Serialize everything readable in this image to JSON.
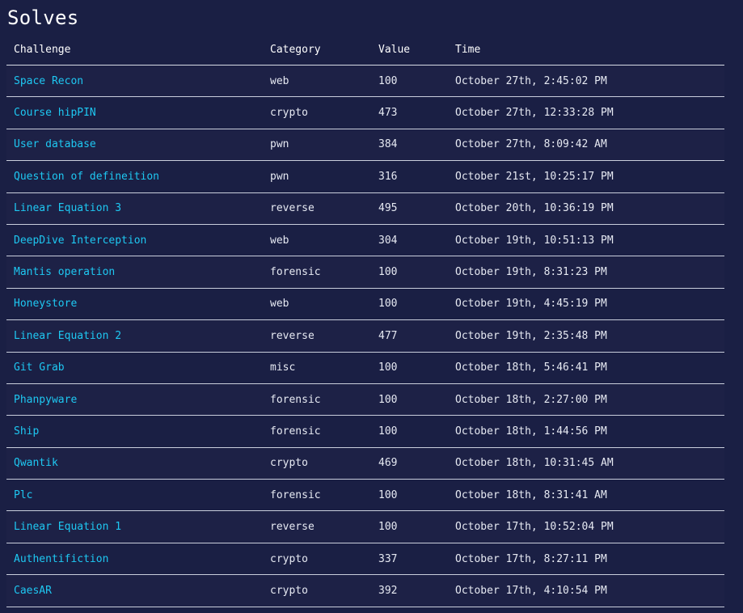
{
  "page": {
    "title": "Solves"
  },
  "table": {
    "headers": {
      "challenge": "Challenge",
      "category": "Category",
      "value": "Value",
      "time": "Time"
    },
    "rows": [
      {
        "challenge": "Space Recon",
        "category": "web",
        "value": "100",
        "time": "October 27th, 2:45:02 PM"
      },
      {
        "challenge": "Course hipPIN",
        "category": "crypto",
        "value": "473",
        "time": "October 27th, 12:33:28 PM"
      },
      {
        "challenge": "User database",
        "category": "pwn",
        "value": "384",
        "time": "October 27th, 8:09:42 AM"
      },
      {
        "challenge": "Question of defineition",
        "category": "pwn",
        "value": "316",
        "time": "October 21st, 10:25:17 PM"
      },
      {
        "challenge": "Linear Equation 3",
        "category": "reverse",
        "value": "495",
        "time": "October 20th, 10:36:19 PM"
      },
      {
        "challenge": "DeepDive Interception",
        "category": "web",
        "value": "304",
        "time": "October 19th, 10:51:13 PM"
      },
      {
        "challenge": "Mantis operation",
        "category": "forensic",
        "value": "100",
        "time": "October 19th, 8:31:23 PM"
      },
      {
        "challenge": "Honeystore",
        "category": "web",
        "value": "100",
        "time": "October 19th, 4:45:19 PM"
      },
      {
        "challenge": "Linear Equation 2",
        "category": "reverse",
        "value": "477",
        "time": "October 19th, 2:35:48 PM"
      },
      {
        "challenge": "Git Grab",
        "category": "misc",
        "value": "100",
        "time": "October 18th, 5:46:41 PM"
      },
      {
        "challenge": "Phanpyware",
        "category": "forensic",
        "value": "100",
        "time": "October 18th, 2:27:00 PM"
      },
      {
        "challenge": "Ship",
        "category": "forensic",
        "value": "100",
        "time": "October 18th, 1:44:56 PM"
      },
      {
        "challenge": "Qwantik",
        "category": "crypto",
        "value": "469",
        "time": "October 18th, 10:31:45 AM"
      },
      {
        "challenge": "Plc",
        "category": "forensic",
        "value": "100",
        "time": "October 18th, 8:31:41 AM"
      },
      {
        "challenge": "Linear Equation 1",
        "category": "reverse",
        "value": "100",
        "time": "October 17th, 10:52:04 PM"
      },
      {
        "challenge": "Authentifiction",
        "category": "crypto",
        "value": "337",
        "time": "October 17th, 8:27:11 PM"
      },
      {
        "challenge": "CaesAR",
        "category": "crypto",
        "value": "392",
        "time": "October 17th, 4:10:54 PM"
      }
    ]
  },
  "colors": {
    "background": "#1a1f44",
    "link": "#1ec8f2",
    "text": "#e6e9f2",
    "divider": "#c9cedc"
  }
}
